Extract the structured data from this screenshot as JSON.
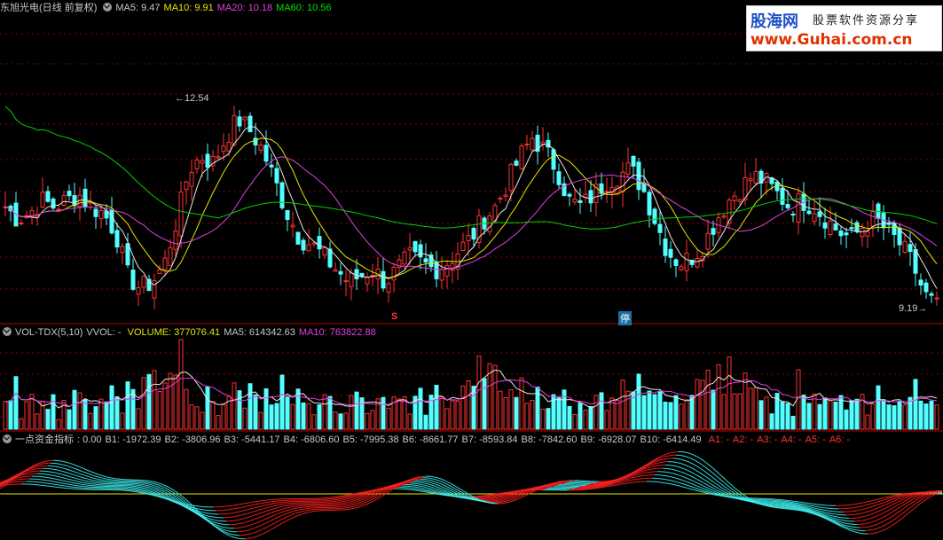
{
  "header": {
    "stock_title": "东旭光电(日线 前复权)",
    "ma5": "MA5: 9.47",
    "ma10": "MA10: 9.91",
    "ma20": "MA20: 10.18",
    "ma60": "MA60: 10.56"
  },
  "logo": {
    "brand": "股海网",
    "slogan": "股票软件资源分享",
    "url": "www.Guhai.com.cn"
  },
  "annotations": {
    "high": "12.54",
    "low": "9.19",
    "marker_s": "S",
    "marker_halt": "停"
  },
  "volume_header": {
    "name": "VOL-TDX(5,10)",
    "vvol": "VVOL: -",
    "volume": "VOLUME: 377076.41",
    "ma5": "MA5: 614342.63",
    "ma10": "MA10: 763822.88"
  },
  "indicator_header": {
    "name": "一点资金指标",
    "value": ": 0.00",
    "items": [
      "B1: -1972.39",
      "B2: -3806.96",
      "B3: -5441.17",
      "B4: -6806.60",
      "B5: -7995.38",
      "B6: -8661.77",
      "B7: -8593.84",
      "B8: -7842.60",
      "B9: -6928.07",
      "B10: -6414.49"
    ],
    "a_items": [
      "A1: -",
      "A2: -",
      "A3: -",
      "A4: -",
      "A5: -",
      "A6: -"
    ]
  },
  "colors": {
    "up": "#ff3232",
    "down": "#54ffff",
    "ma5": "#e6e6e6",
    "ma10": "#e6e600",
    "ma20": "#e040e0",
    "ma60": "#00d000",
    "grid": "#8a0000"
  },
  "chart_data": [
    {
      "type": "candlestick",
      "title": "东旭光电(日线 前复权)",
      "series": [
        {
          "name": "MA5",
          "values": [
            9.47
          ]
        },
        {
          "name": "MA10",
          "values": [
            9.91
          ]
        },
        {
          "name": "MA20",
          "values": [
            10.18
          ]
        },
        {
          "name": "MA60",
          "values": [
            10.56
          ]
        }
      ],
      "annotations": [
        {
          "label": "12.54",
          "kind": "high"
        },
        {
          "label": "9.19",
          "kind": "low"
        }
      ],
      "close_path": [
        10.8,
        10.6,
        10.7,
        10.9,
        10.8,
        10.9,
        11.0,
        10.8,
        10.7,
        10.4,
        9.7,
        9.5,
        9.6,
        9.9,
        10.6,
        11.4,
        11.6,
        11.5,
        11.9,
        12.2,
        12.0,
        11.7,
        11.2,
        10.7,
        10.3,
        10.2,
        10.0,
        9.8,
        9.6,
        9.7,
        9.8,
        9.6,
        9.8,
        10.0,
        9.9,
        9.8,
        9.9,
        10.1,
        10.3,
        10.6,
        10.8,
        11.2,
        11.6,
        11.9,
        11.7,
        11.4,
        10.9,
        10.8,
        11.0,
        11.2,
        11.3,
        11.4,
        11.1,
        10.6,
        10.1,
        9.9,
        10.0,
        10.2,
        10.6,
        10.9,
        11.1,
        11.3,
        11.2,
        11.0,
        10.8,
        10.9,
        10.8,
        10.6,
        10.4,
        10.3,
        10.5,
        10.6,
        10.4,
        10.2,
        9.9,
        9.4,
        9.2
      ]
    },
    {
      "type": "bar",
      "title": "VOL-TDX(5,10)",
      "series": [
        {
          "name": "VOLUME",
          "values": [
            377076.41
          ]
        },
        {
          "name": "MA5",
          "values": [
            614342.63
          ]
        },
        {
          "name": "MA10",
          "values": [
            763822.88
          ]
        }
      ]
    },
    {
      "type": "area",
      "title": "一点资金指标",
      "series": [
        {
          "name": "B1",
          "values": [
            -1972.39
          ]
        },
        {
          "name": "B2",
          "values": [
            -3806.96
          ]
        },
        {
          "name": "B3",
          "values": [
            -5441.17
          ]
        },
        {
          "name": "B4",
          "values": [
            -6806.6
          ]
        },
        {
          "name": "B5",
          "values": [
            -7995.38
          ]
        },
        {
          "name": "B6",
          "values": [
            -8661.77
          ]
        },
        {
          "name": "B7",
          "values": [
            -8593.84
          ]
        },
        {
          "name": "B8",
          "values": [
            -7842.6
          ]
        },
        {
          "name": "B9",
          "values": [
            -6928.07
          ]
        },
        {
          "name": "B10",
          "values": [
            -6414.49
          ]
        }
      ]
    }
  ]
}
